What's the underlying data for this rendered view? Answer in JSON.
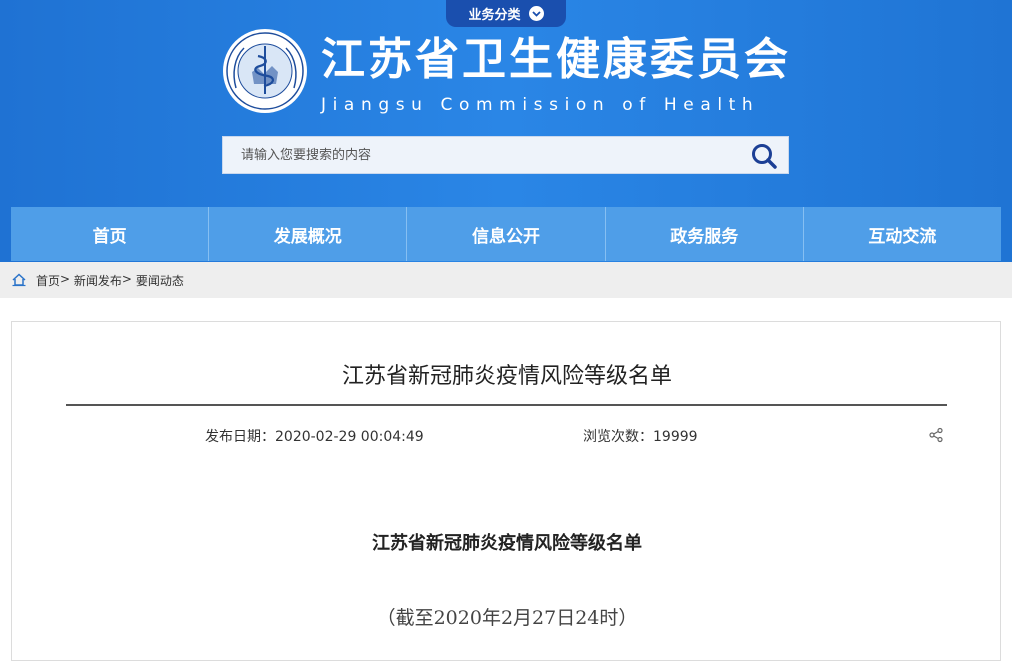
{
  "header": {
    "business_tab": "业务分类",
    "title_cn": "江苏省卫生健康委员会",
    "title_en": "Jiangsu Commission of Health",
    "search_placeholder": "请输入您要搜索的内容",
    "colors": {
      "primary": "#2a86e6",
      "nav": "#4f9ee8",
      "tab": "#1a4fae"
    }
  },
  "nav": {
    "items": [
      {
        "label": "首页"
      },
      {
        "label": "发展概况"
      },
      {
        "label": "信息公开"
      },
      {
        "label": "政务服务"
      },
      {
        "label": "互动交流"
      }
    ]
  },
  "breadcrumb": {
    "items": [
      "首页",
      "新闻发布",
      "要闻动态"
    ],
    "separator": ">"
  },
  "article": {
    "title": "江苏省新冠肺炎疫情风险等级名单",
    "date": "发布日期：2020-02-29 00:04:49",
    "views": "浏览次数：19999",
    "body_title": "江苏省新冠肺炎疫情风险等级名单",
    "body_subtitle": "（截至2020年2月27日24时）"
  },
  "icons": {
    "emblem": "health-emblem-icon",
    "search": "search-icon",
    "home": "home-icon",
    "share": "share-icon",
    "chevron": "chevron-down-icon"
  }
}
